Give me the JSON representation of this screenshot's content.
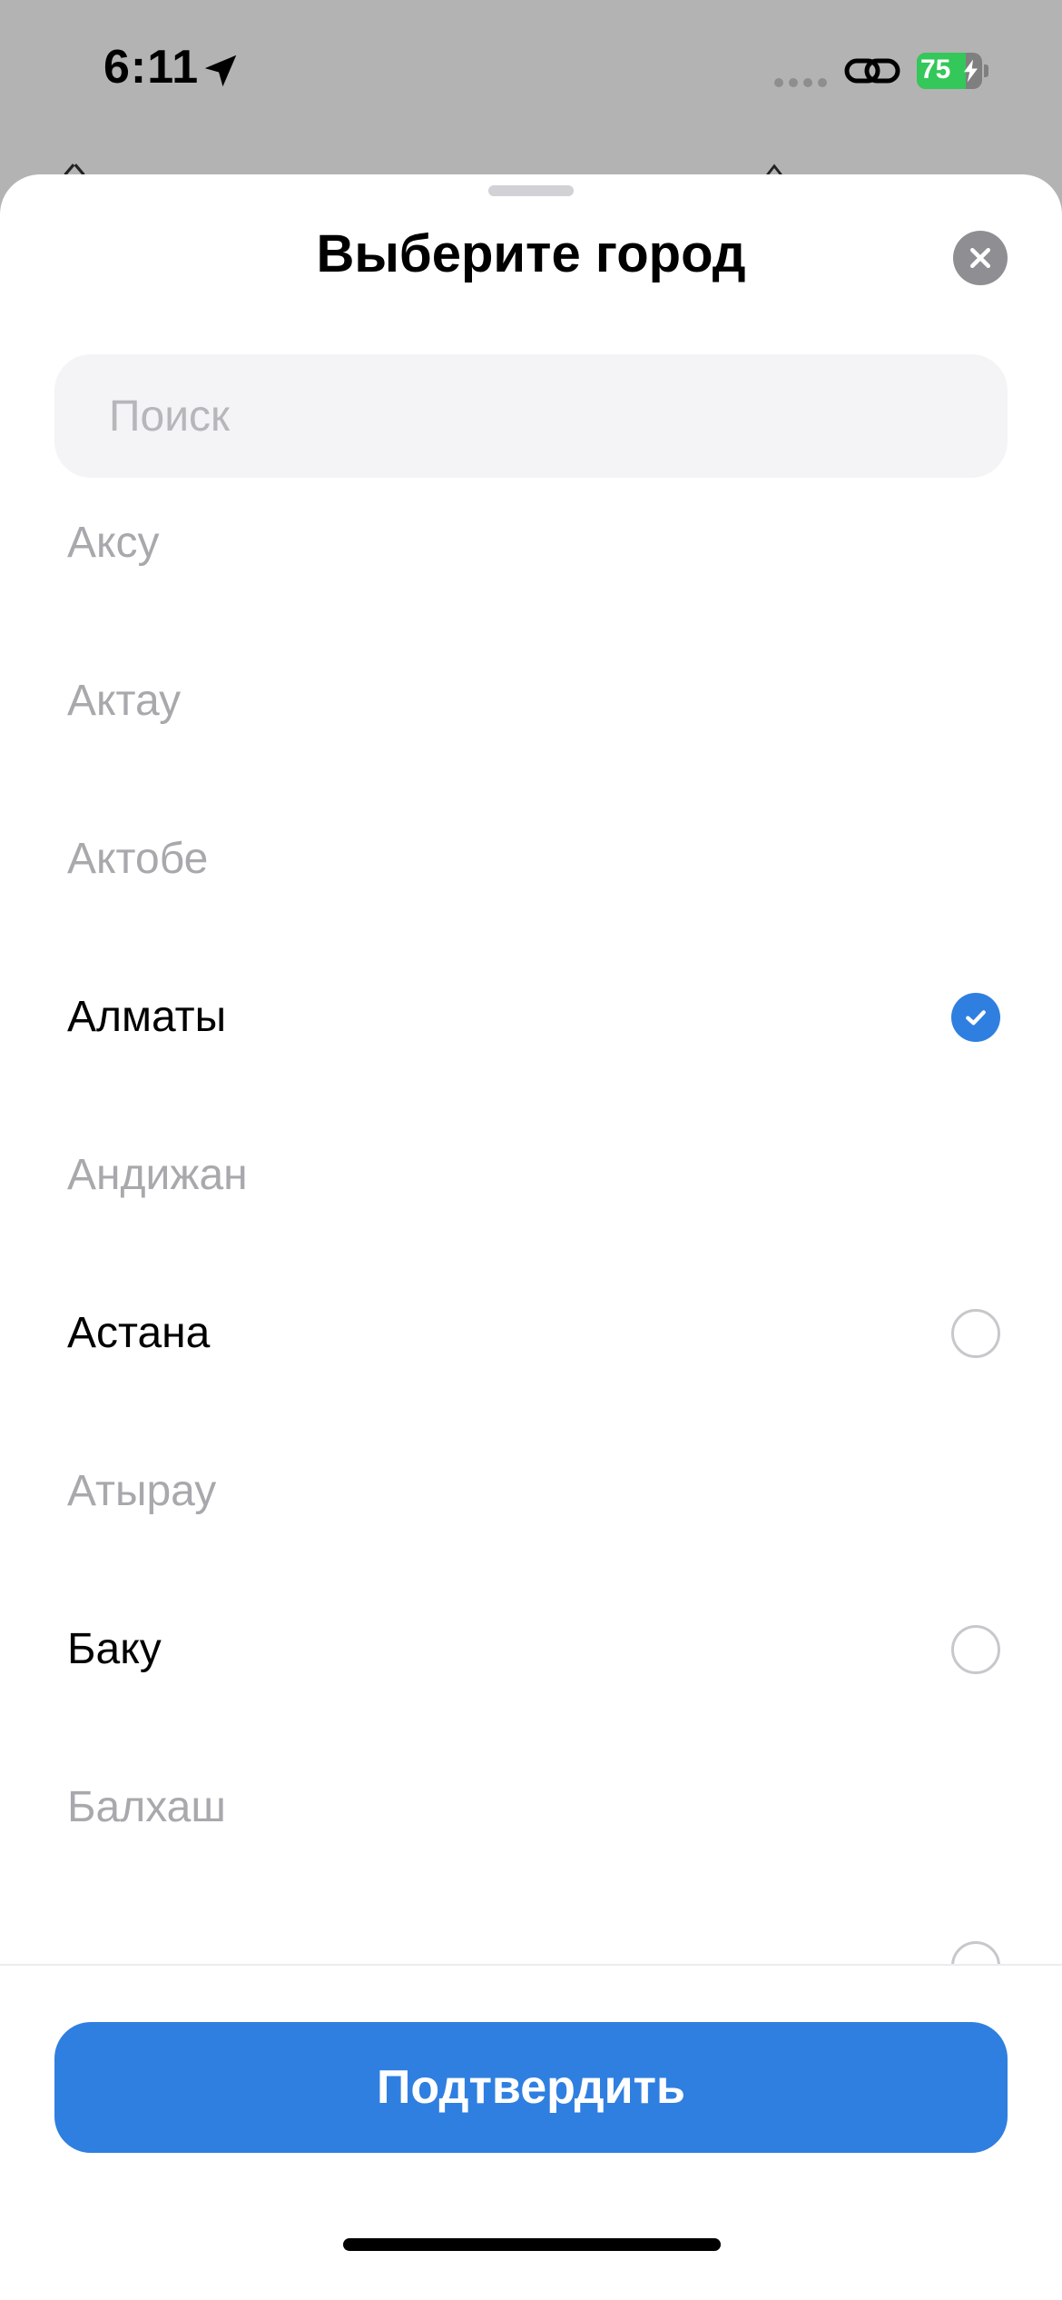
{
  "status_bar": {
    "time": "6:11",
    "battery_percent": "75",
    "battery_level": 0.75,
    "location_icon": "location-arrow-icon",
    "link_icon": "link-icon",
    "charging_icon": "bolt-icon"
  },
  "sheet": {
    "title": "Выберите город",
    "close_icon": "close-icon"
  },
  "search": {
    "placeholder": "Поиск",
    "value": ""
  },
  "cities": [
    {
      "label": "Аксу",
      "available": false,
      "selected": false
    },
    {
      "label": "Актау",
      "available": false,
      "selected": false
    },
    {
      "label": "Актобе",
      "available": false,
      "selected": false
    },
    {
      "label": "Алматы",
      "available": true,
      "selected": true
    },
    {
      "label": "Андижан",
      "available": false,
      "selected": false
    },
    {
      "label": "Астана",
      "available": true,
      "selected": false
    },
    {
      "label": "Атырау",
      "available": false,
      "selected": false
    },
    {
      "label": "Баку",
      "available": true,
      "selected": false
    },
    {
      "label": "Балхаш",
      "available": false,
      "selected": false
    },
    {
      "label": "",
      "available": true,
      "selected": false
    }
  ],
  "footer": {
    "confirm_label": "Подтвердить"
  },
  "colors": {
    "accent": "#2f7fe0",
    "disabled_text": "#a8a8ad",
    "battery_green": "#34c759",
    "overlay": "#b3b3b3"
  }
}
